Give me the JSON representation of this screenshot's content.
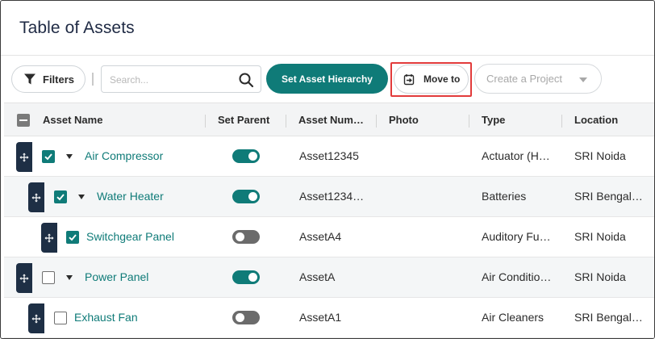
{
  "page": {
    "title": "Table of Assets"
  },
  "toolbar": {
    "filters_label": "Filters",
    "search_placeholder": "Search...",
    "search_value": "",
    "set_hierarchy_label": "Set Asset Hierarchy",
    "move_to_label": "Move to",
    "create_project_label": "Create a Project"
  },
  "colors": {
    "accent": "#0f7b78",
    "handle": "#1e2f45",
    "highlight": "#e23b3b",
    "toggle_off": "#6b6b6b"
  },
  "table": {
    "headers": {
      "asset_name": "Asset Name",
      "set_parent": "Set Parent",
      "asset_number": "Asset Num…",
      "photo": "Photo",
      "type": "Type",
      "location": "Location"
    },
    "rows": [
      {
        "name": "Air Compressor",
        "checked": true,
        "expandable": true,
        "indent": 0,
        "set_parent": true,
        "asset_number": "Asset12345",
        "photo": "",
        "type": "Actuator (H…",
        "location": "SRI Noida"
      },
      {
        "name": "Water Heater",
        "checked": true,
        "expandable": true,
        "indent": 1,
        "set_parent": true,
        "asset_number": "Asset1234…",
        "photo": "",
        "type": "Batteries",
        "location": "SRI Bengal…"
      },
      {
        "name": "Switchgear Panel",
        "checked": true,
        "expandable": false,
        "indent": 2,
        "set_parent": false,
        "asset_number": "AssetA4",
        "photo": "",
        "type": "Auditory Fu…",
        "location": "SRI Noida"
      },
      {
        "name": "Power Panel",
        "checked": false,
        "expandable": true,
        "indent": 0,
        "set_parent": true,
        "asset_number": "AssetA",
        "photo": "",
        "type": "Air Conditio…",
        "location": "SRI Noida"
      },
      {
        "name": "Exhaust Fan",
        "checked": false,
        "expandable": false,
        "indent": 1,
        "set_parent": false,
        "asset_number": "AssetA1",
        "photo": "",
        "type": "Air Cleaners",
        "location": "SRI Bengal…"
      }
    ]
  }
}
